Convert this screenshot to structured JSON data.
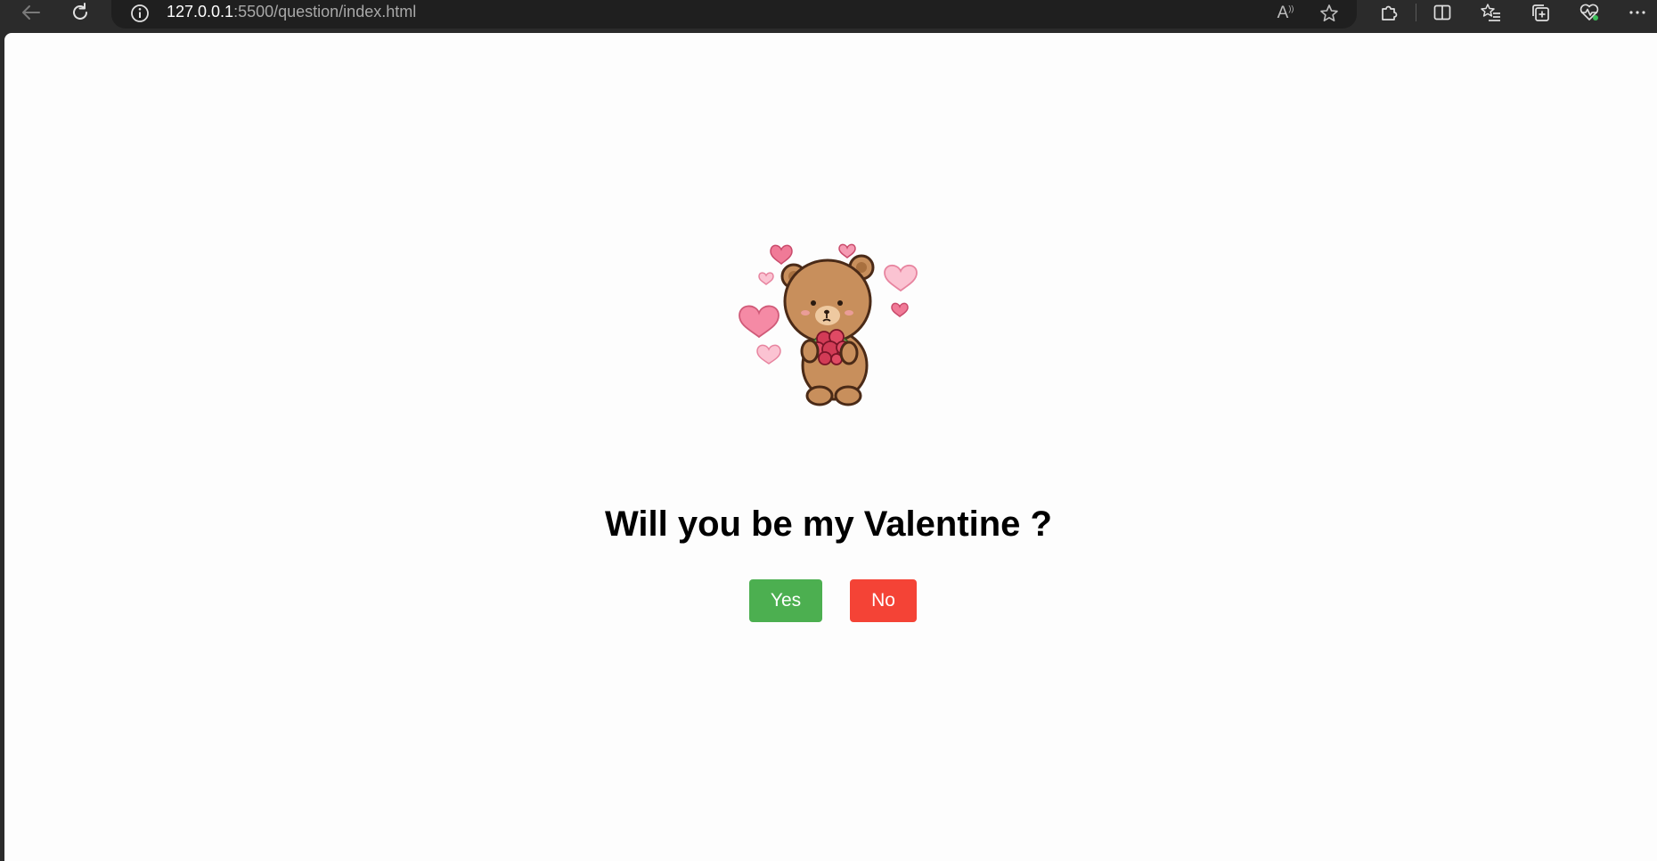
{
  "browser": {
    "url_host": "127.0.0.1",
    "url_rest": ":5500/question/index.html",
    "read_aloud_label": "A",
    "read_aloud_sup": "))"
  },
  "page": {
    "question": "Will you be my Valentine ?",
    "yes_label": "Yes",
    "no_label": "No"
  },
  "colors": {
    "yes_button": "#4caf50",
    "no_button": "#f44336",
    "page_background": "#fdfdfd",
    "browser_chrome": "#2b2b2b"
  },
  "icons": [
    "back-arrow-icon",
    "refresh-icon",
    "info-icon",
    "read-aloud-icon",
    "favorite-star-icon",
    "extensions-icon",
    "split-screen-icon",
    "favorites-icon",
    "collections-icon",
    "browser-essentials-icon",
    "more-icon",
    "teddy-bear-image",
    "heart-icon"
  ]
}
